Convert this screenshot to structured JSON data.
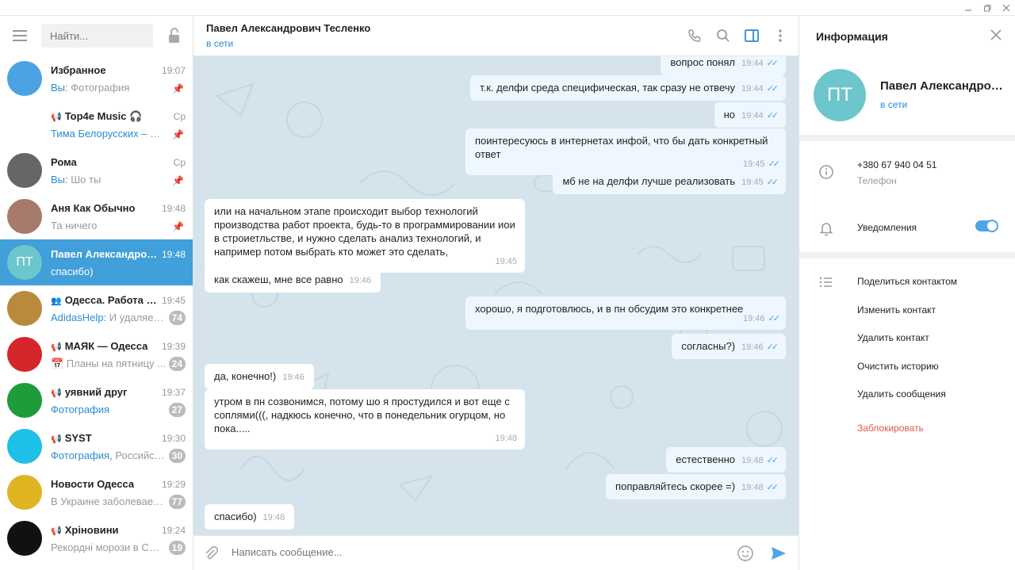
{
  "sidebar": {
    "search_placeholder": "Найти...",
    "chats": [
      {
        "name": "Избранное",
        "mark": "",
        "time": "19:07",
        "who": "Вы:",
        "msg": "Фотография",
        "badge": "",
        "pinned": true,
        "avatar_color": "#4ba3e3",
        "avatar_text": "",
        "avatar_icon": "bookmark-icon"
      },
      {
        "name": "Top4e Music 🎧",
        "mark": "📢",
        "time": "Ср",
        "who": "Тима Белорусских – Я Б...",
        "msg": "",
        "badge": "",
        "pinned": true,
        "avatar_color": "#ffffff",
        "avatar_text": "",
        "avatar_icon": "top4e-logo"
      },
      {
        "name": "Рома",
        "mark": "",
        "time": "Ср",
        "who": "Вы:",
        "msg": "Шо ты",
        "badge": "",
        "pinned": true,
        "avatar_color": "#666666",
        "avatar_text": "",
        "avatar_icon": "photo-avatar"
      },
      {
        "name": "Аня Как Обычно",
        "mark": "",
        "time": "19:48",
        "who": "",
        "msg": "Та ничего",
        "badge": "",
        "pinned": true,
        "avatar_color": "#a67b6b",
        "avatar_text": "",
        "avatar_icon": "photo-avatar"
      },
      {
        "name": "Павел Александров...",
        "mark": "",
        "time": "19:48",
        "who": "",
        "msg": "спасибо)",
        "badge": "",
        "pinned": false,
        "avatar_color": "#6cc6cb",
        "avatar_text": "ПТ",
        "avatar_icon": ""
      },
      {
        "name": "Одесса. Работа и...",
        "mark": "👥",
        "time": "19:45",
        "who": "AdidasHelp:",
        "msg": "И удаляешь",
        "badge": "74",
        "pinned": false,
        "avatar_color": "#b88a3b",
        "avatar_text": "",
        "avatar_icon": "photo-avatar"
      },
      {
        "name": "МАЯК — Одесса",
        "mark": "📢",
        "time": "19:39",
        "who": "",
        "msg": "📅 Планы на пятницу ...",
        "badge": "24",
        "pinned": false,
        "avatar_color": "#d6262c",
        "avatar_text": "",
        "avatar_icon": "mayak-logo"
      },
      {
        "name": "уявний друг",
        "mark": "📢",
        "time": "19:37",
        "who": "Фотография",
        "msg": "",
        "badge": "27",
        "pinned": false,
        "avatar_color": "#1e9b3a",
        "avatar_text": "",
        "avatar_icon": "photo-avatar"
      },
      {
        "name": "SYST",
        "mark": "📢",
        "time": "19:30",
        "who": "Фотография,",
        "msg": " Российск...",
        "badge": "30",
        "pinned": false,
        "avatar_color": "#1ec0e8",
        "avatar_text": "",
        "avatar_icon": "syst-logo"
      },
      {
        "name": "Новости Одесса",
        "mark": "",
        "time": "19:29",
        "who": "",
        "msg": "В Украине заболеваем...",
        "badge": "77",
        "pinned": false,
        "avatar_color": "#e0b421",
        "avatar_text": "",
        "avatar_icon": "odessa-emblem"
      },
      {
        "name": "Хріновини",
        "mark": "📢",
        "time": "19:24",
        "who": "",
        "msg": "Рекордні морози в СШ...",
        "badge": "19",
        "pinned": false,
        "avatar_color": "#111111",
        "avatar_text": "",
        "avatar_icon": "hrinovyny-logo"
      }
    ]
  },
  "header": {
    "title": "Павел Александрович Тесленко",
    "status": "в сети"
  },
  "messages": [
    {
      "text": "вопрос понял",
      "time": "19:44",
      "out": true
    },
    {
      "text": "т.к. делфи среда специфическая, так сразу не отвечу",
      "time": "19:44",
      "out": true
    },
    {
      "text": "но",
      "time": "19:44",
      "out": true
    },
    {
      "text": "поинтересуюсь в интернетах инфой, что бы дать конкретный ответ",
      "time": "19:45",
      "out": true
    },
    {
      "text": "мб не на делфи лучше реализовать",
      "time": "19:45",
      "out": true
    },
    {
      "text": "или на начальном этапе происходит выбор технологий производства работ проекта, будь-то в программировании иои в строиетльстве, и нужно сделать анализ технологий, и например потом выбрать кто может это сделать,",
      "time": "19:45",
      "out": false
    },
    {
      "text": "как скажеш, мне все равно",
      "time": "19:46",
      "out": false
    },
    {
      "text": "хорошо, я подготовлюсь, и в пн обсудим это конкретнее",
      "time": "19:46",
      "out": true
    },
    {
      "text": "согласны?)",
      "time": "19:46",
      "out": true
    },
    {
      "text": "да, конечно!)",
      "time": "19:46",
      "out": false
    },
    {
      "text": "утром в пн созвонимся, потому шо я простудился и вот еще с соплями(((, надкюсь конечно, что в понедельник огурцом, но пока.....",
      "time": "19:48",
      "out": false
    },
    {
      "text": "естественно",
      "time": "19:48",
      "out": true
    },
    {
      "text": "поправляйтесь скорее =)",
      "time": "19:48",
      "out": true
    },
    {
      "text": "спасибо)",
      "time": "19:48",
      "out": false
    }
  ],
  "composer": {
    "placeholder": "Написать сообщение..."
  },
  "info": {
    "title": "Информация",
    "avatar_text": "ПТ",
    "name": "Павел Александрович Тесленко",
    "status": "в сети",
    "phone": "+380 67 940 04 51",
    "phone_label": "Телефон",
    "notifications": "Уведомления",
    "notifications_on": true,
    "actions": [
      "Поделиться контактом",
      "Изменить контакт",
      "Удалить контакт",
      "Очистить историю",
      "Удалить сообщения"
    ],
    "block": "Заблокировать"
  },
  "colors": {
    "accent": "#419fd9",
    "online": "#2a8cd0",
    "danger": "#e0574e",
    "chat_bg": "#d5e3ec"
  }
}
